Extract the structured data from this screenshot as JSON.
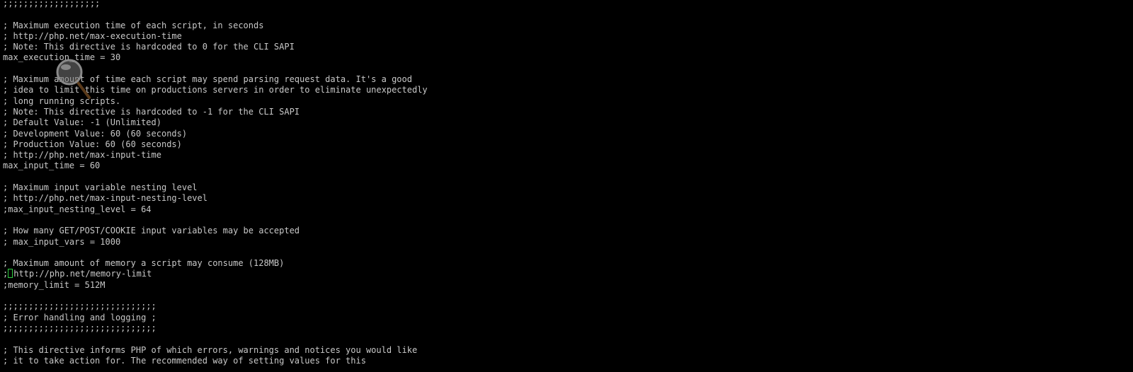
{
  "terminal": {
    "lines": [
      ";;;;;;;;;;;;;;;;;;;",
      "",
      "; Maximum execution time of each script, in seconds",
      "; http://php.net/max-execution-time",
      "; Note: This directive is hardcoded to 0 for the CLI SAPI",
      "max_execution_time = 30",
      "",
      "; Maximum amount of time each script may spend parsing request data. It's a good",
      "; idea to limit this time on productions servers in order to eliminate unexpectedly",
      "; long running scripts.",
      "; Note: This directive is hardcoded to -1 for the CLI SAPI",
      "; Default Value: -1 (Unlimited)",
      "; Development Value: 60 (60 seconds)",
      "; Production Value: 60 (60 seconds)",
      "; http://php.net/max-input-time",
      "max_input_time = 60",
      "",
      "; Maximum input variable nesting level",
      "; http://php.net/max-input-nesting-level",
      ";max_input_nesting_level = 64",
      "",
      "; How many GET/POST/COOKIE input variables may be accepted",
      "; max_input_vars = 1000",
      "",
      "; Maximum amount of memory a script may consume (128MB)",
      ";",
      ";memory_limit = 512M",
      "",
      ";;;;;;;;;;;;;;;;;;;;;;;;;;;;;;",
      "; Error handling and logging ;",
      ";;;;;;;;;;;;;;;;;;;;;;;;;;;;;;",
      "",
      "; This directive informs PHP of which errors, warnings and notices you would like",
      "; it to take action for. The recommended way of setting values for this"
    ],
    "cursor_line_text": "http://php.net/memory-limit",
    "colors": {
      "background": "#000000",
      "text": "#c8c8c8",
      "cursor": "#2ecc40"
    }
  }
}
